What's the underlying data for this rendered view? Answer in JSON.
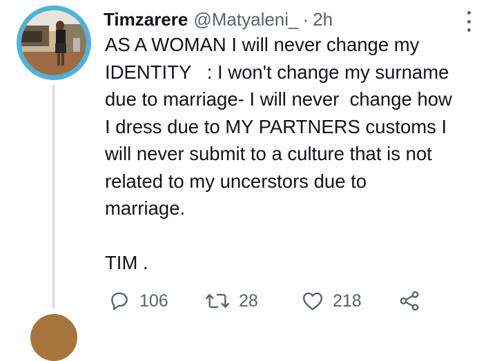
{
  "tweet": {
    "display_name": "Timzarere",
    "handle": "@Matyaleni_",
    "separator": "·",
    "time": "2h",
    "body_lines": [
      "AS A WOMAN I will never change my",
      "IDENTITY   : I won't change my surname",
      "due to marriage- I will never  change how",
      "I dress due to MY PARTNERS customs I",
      "will never submit to a culture that is not",
      "related to my uncerstors due to",
      "marriage.",
      "",
      "TIM ."
    ],
    "actions": {
      "replies": "106",
      "retweets": "28",
      "likes": "218"
    }
  },
  "icons": {
    "more": "more-options-icon",
    "reply": "reply-icon",
    "retweet": "retweet-icon",
    "like": "heart-icon",
    "share": "share-icon"
  },
  "colors": {
    "avatar_ring": "#4fb3d9",
    "secondary_text": "#536471",
    "thread_line": "#cfd9de"
  }
}
